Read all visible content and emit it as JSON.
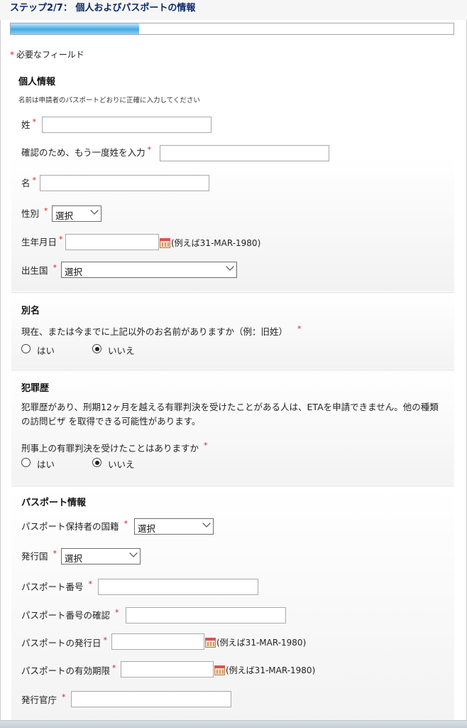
{
  "header": {
    "title": "ステップ2/7：  個人およびパスポートの情報",
    "progress_fraction": 0.29
  },
  "required_note": {
    "star": "*",
    "text": "必要なフィールド"
  },
  "required_star": "*",
  "personal": {
    "heading": "個人情報",
    "note": "名前は申請者のパスポートどおりに正確に入力してください",
    "surname_label": "姓",
    "surname_confirm_label": "確認のため、もう一度姓を入力",
    "given_name_label": "名",
    "gender_label": "性別",
    "gender_value": "選択",
    "dob_label": "生年月日",
    "dob_hint": "(例えば31-MAR-1980)",
    "birth_country_label": "出生国",
    "birth_country_value": "選択"
  },
  "alias": {
    "heading": "別名",
    "question": "現在、または今までに上記以外のお名前がありますか（例：旧姓）",
    "yes": "はい",
    "no": "いいえ",
    "selected": "no"
  },
  "criminal": {
    "heading": "犯罪歴",
    "info": "犯罪歴があり、刑期12ヶ月を越える有罪判決を受けたことがある人は、ETAを申請できません。他の種類の訪問ビザ を取得できる可能性があります。",
    "question": "刑事上の有罪判決を受けたことはありますか",
    "yes": "はい",
    "no": "いいえ",
    "selected": "no"
  },
  "passport": {
    "heading": "パスポート情報",
    "nationality_label": "パスポート保持者の国籍",
    "nationality_value": "選択",
    "issuing_country_label": "発行国",
    "issuing_country_value": "選択",
    "number_label": "パスポート番号",
    "number_confirm_label": "パスポート番号の確認",
    "issue_date_label": "パスポートの発行日",
    "issue_date_hint": "(例えば31-MAR-1980)",
    "expiry_label": "パスポートの有効期限",
    "expiry_hint": "(例えば31-MAR-1980)",
    "authority_label": "発行官庁"
  },
  "icons": {
    "calendar": "calendar-icon",
    "dropdown": "chevron-down-icon"
  },
  "colors": {
    "title": "#0b2a66",
    "required": "#d42020",
    "progress": "#45a9e3"
  }
}
